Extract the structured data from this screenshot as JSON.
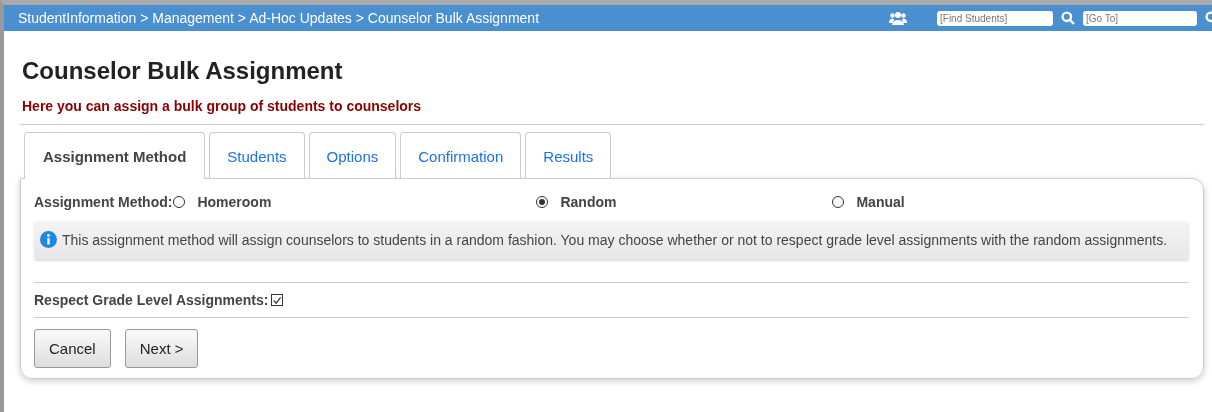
{
  "top_bar": {
    "breadcrumb": "StudentInformation > Management > Ad-Hoc Updates > Counselor Bulk Assignment",
    "find_field": {
      "placeholder": "[Find Students]"
    },
    "goto_field": {
      "placeholder": "[Go To]"
    }
  },
  "page": {
    "title": "Counselor Bulk Assignment",
    "subtitle": "Here you can assign a bulk group of students to counselors"
  },
  "tabs": [
    {
      "label": "Assignment Method",
      "selected": true
    },
    {
      "label": "Students",
      "selected": false
    },
    {
      "label": "Options",
      "selected": false
    },
    {
      "label": "Confirmation",
      "selected": false
    },
    {
      "label": "Results",
      "selected": false
    }
  ],
  "method": {
    "label": "Assignment Method:",
    "options": [
      {
        "label": "Homeroom",
        "selected": false
      },
      {
        "label": "Random",
        "selected": true
      },
      {
        "label": "Manual",
        "selected": false
      }
    ]
  },
  "info": "This assignment method will assign counselors to students in a random fashion. You may choose whether or not to respect grade level assignments with the random assignments.",
  "respect": {
    "label": "Respect Grade Level Assignments:",
    "checked": true
  },
  "buttons": [
    "Cancel",
    "Next >"
  ]
}
